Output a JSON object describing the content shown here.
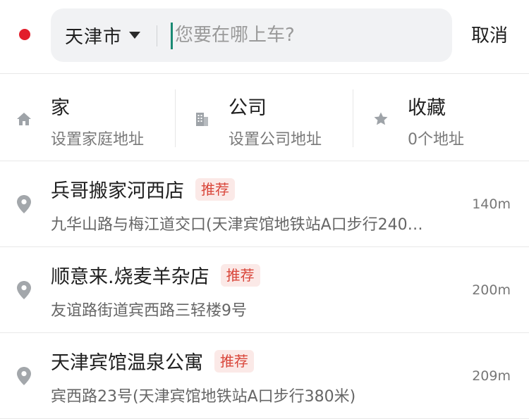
{
  "header": {
    "city": "天津市",
    "search_placeholder": "您要在哪上车?",
    "cancel_label": "取消"
  },
  "shortcuts": [
    {
      "title": "家",
      "subtitle": "设置家庭地址",
      "icon": "home-icon"
    },
    {
      "title": "公司",
      "subtitle": "设置公司地址",
      "icon": "building-icon"
    },
    {
      "title": "收藏",
      "subtitle": "0个地址",
      "icon": "star-icon"
    }
  ],
  "places": [
    {
      "name": "兵哥搬家河西店",
      "tag": "推荐",
      "address": "九华山路与梅江道交口(天津宾馆地铁站A口步行240…",
      "distance": "140m"
    },
    {
      "name": "顺意来.烧麦羊杂店",
      "tag": "推荐",
      "address": "友谊路街道宾西路三轻楼9号",
      "distance": "200m"
    },
    {
      "name": "天津宾馆温泉公寓",
      "tag": "推荐",
      "address": "宾西路23号(天津宾馆地铁站A口步行380米)",
      "distance": "209m"
    }
  ],
  "colors": {
    "origin_dot": "#e21d2b",
    "tag_text": "#d9463a",
    "tag_bg": "#fbe9e7",
    "cursor": "#1a8a74",
    "icon_gray": "#9ea3a8"
  }
}
